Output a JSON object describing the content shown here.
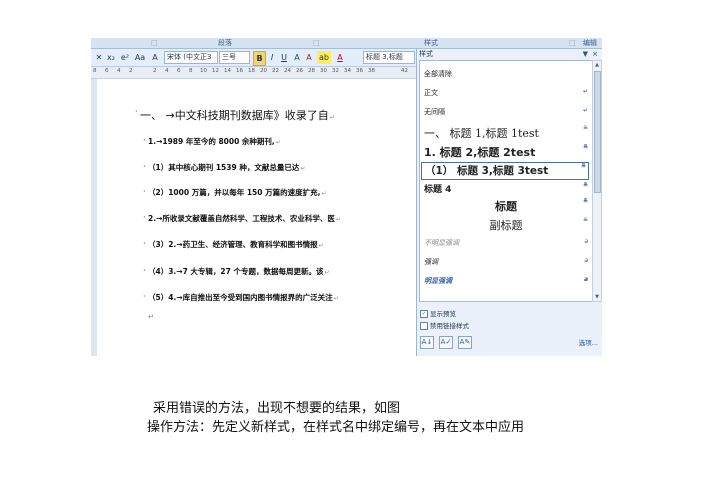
{
  "ribbon": {
    "groups": [
      "段落",
      "样式",
      "编辑"
    ],
    "launcher_glyph": "⬚"
  },
  "toolbar": {
    "buttons": [
      "✕",
      "x₂",
      "e²",
      "Aa",
      "A",
      "B",
      "I",
      "U",
      "A",
      "A",
      "ab",
      "A"
    ],
    "font_name": "宋体 (中文正3",
    "font_size": "三号",
    "style_name": "标题 3,标题"
  },
  "ruler": {
    "ticks": [
      "8",
      "6",
      "4",
      "2",
      "",
      "2",
      "4",
      "6",
      "8",
      "10",
      "12",
      "14",
      "16",
      "18",
      "20",
      "22",
      "24",
      "26",
      "28",
      "30",
      "32",
      "34",
      "36",
      "38",
      "",
      "42"
    ]
  },
  "document": {
    "lines": [
      {
        "text": "一、 →中文科技期刊数据库》收录了自",
        "mark": "↵",
        "heading": true
      },
      {
        "text": "1.→1989 年至今的 8000 余种期刊,",
        "mark": "↵"
      },
      {
        "text": "（1）其中核心期刊 1539 种，文献总量已达",
        "mark": "↵"
      },
      {
        "text": "（2）1000 万篇，并以每年 150 万篇的速度扩充,",
        "mark": "↵"
      },
      {
        "text": "2.→所收录文献覆盖自然科学、工程技术、农业科学、医",
        "mark": "↵"
      },
      {
        "text": "（3）2.→药卫生、经济管理、教育科学和图书情报",
        "mark": "↵"
      },
      {
        "text": "（4）3.→7 大专辑，27 个专题，数据每周更新。该",
        "mark": "↵"
      },
      {
        "text": "（5）4.→库自推出至今受到国内图书情报界的广泛关注",
        "mark": "↵"
      }
    ],
    "empty_mark": "↵"
  },
  "styles_pane": {
    "title": "样式",
    "close": "×",
    "dropdown": "▼",
    "items": [
      {
        "label": "全部清除",
        "key": ""
      },
      {
        "label": "正文",
        "key": "↵"
      },
      {
        "label": "无间隔",
        "key": "↵"
      },
      {
        "label": "一、  标题 1,标题 1test",
        "key": "≞"
      },
      {
        "label": "1. 标题 2,标题 2test",
        "key": "≞"
      },
      {
        "label": "（1） 标题 3,标题 3test",
        "key": "≞"
      },
      {
        "label": "标题 4",
        "key": "≞"
      },
      {
        "label": "标题",
        "key": "≞"
      },
      {
        "label": "副标题",
        "key": "≞"
      },
      {
        "label": "不明显强调",
        "key": "a"
      },
      {
        "label": "强调",
        "key": "a"
      },
      {
        "label": "明显强调",
        "key": "a"
      }
    ],
    "show_preview": "显示预览",
    "disable_linked": "禁用链接样式",
    "show_preview_checked": true,
    "disable_linked_checked": false,
    "bottom_buttons": [
      "A↓",
      "A✓",
      "A✎"
    ],
    "options": "选项..."
  },
  "captions": {
    "line1": "采用错误的方法，出现不想要的结果，如图",
    "line2": "操作方法：先定义新样式，在样式名中绑定编号，再在文本中应用"
  }
}
